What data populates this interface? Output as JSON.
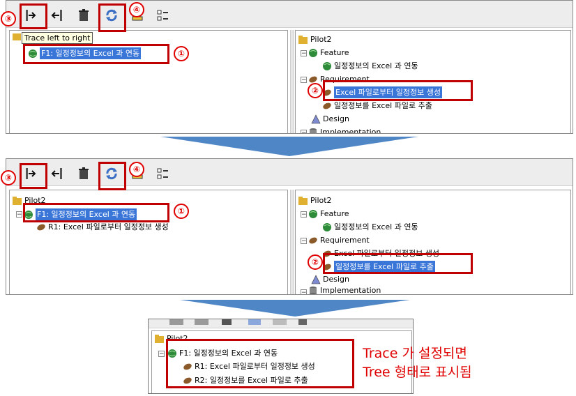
{
  "tooltip": "Trace left to right",
  "markers": {
    "m1": "①",
    "m2": "②",
    "m3": "③",
    "m4": "④"
  },
  "panel1": {
    "left_tree": {
      "f1": "F1: 일정정보의 Excel 과 연동"
    },
    "right_tree": {
      "root": "Pilot2",
      "feature": "Feature",
      "feature_child": "일정정보의 Excel 과 연동",
      "requirement": "Requirement",
      "req1": "Excel 파일로부터 일정정보 생성",
      "req2": "일정정보를 Excel 파일로 추출",
      "design": "Design",
      "implementation": "Implementation"
    }
  },
  "panel2": {
    "left_tree": {
      "root": "Pilot2",
      "f1": "F1: 일정정보의 Excel 과 연동",
      "r1": "R1: Excel 파일로부터 일정정보 생성"
    },
    "right_tree": {
      "root": "Pilot2",
      "feature": "Feature",
      "feature_child": "일정정보의 Excel 과 연동",
      "requirement": "Requirement",
      "req1": "Excel 파일로부터 일정정보 생성",
      "req2": "일정정보를 Excel 파일로 추출",
      "design": "Design",
      "implementation": "Implementation"
    }
  },
  "panel3": {
    "root": "Pilot2",
    "f1": "F1: 일정정보의 Excel 과 연동",
    "r1": "R1: Excel 파일로부터 일정정보 생성",
    "r2": "R2: 일정정보를 Excel 파일로 추출"
  },
  "caption": {
    "line1": "Trace 가 설정되면",
    "line2": "Tree 형태로 표시됨"
  },
  "colors": {
    "accent_red": "#c00000",
    "selection": "#3a75d8",
    "arrow": "#4f86c6"
  }
}
